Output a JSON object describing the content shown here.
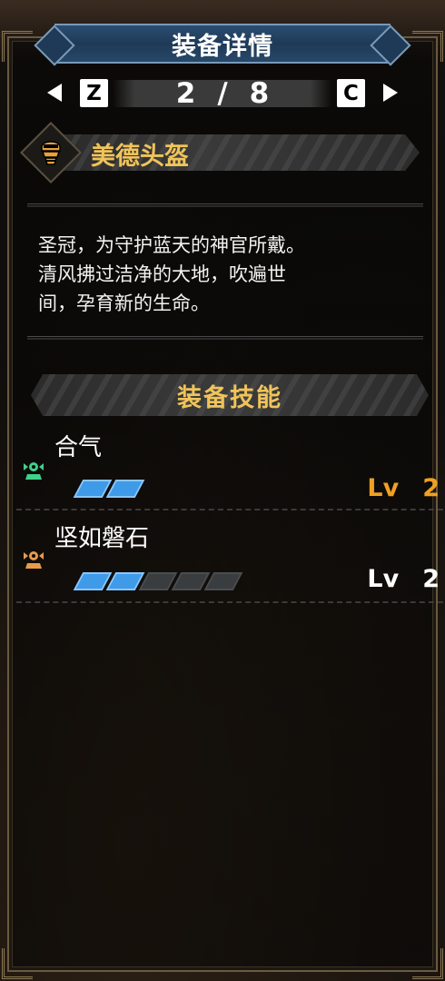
{
  "title": "装备详情",
  "pager": {
    "left_key": "Z",
    "right_key": "C",
    "current": "2",
    "separator": "/",
    "total": "8"
  },
  "item": {
    "name": "美德头盔",
    "icon": "helmet-icon",
    "description": [
      "圣冠，为守护蓝天的神官所戴。",
      "清风拂过洁净的大地，吹遍世",
      "间，孕育新的生命。"
    ]
  },
  "skills_section": {
    "title": "装备技能",
    "skills": [
      {
        "name": "合气",
        "icon": "skill-emblem-icon",
        "icon_color": "#3fd08a",
        "level_label": "Lv",
        "level": "2",
        "level_color": "#f0a020",
        "filled": 2,
        "max": 2
      },
      {
        "name": "坚如磐石",
        "icon": "skill-emblem-icon",
        "icon_color": "#e89a4a",
        "level_label": "Lv",
        "level": "2",
        "level_color": "#ffffff",
        "filled": 2,
        "max": 6
      }
    ]
  },
  "colors": {
    "accent_gold": "#f0c45a",
    "title_blue": "#2c4e72",
    "bar_blue": "#3f9be8"
  }
}
